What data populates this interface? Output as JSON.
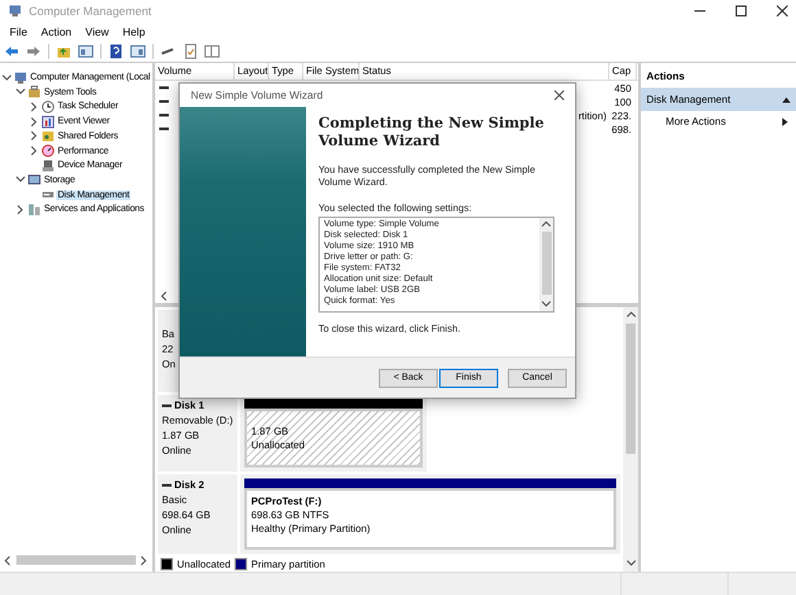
{
  "window": {
    "title": "Computer Management"
  },
  "menu": [
    "File",
    "Action",
    "View",
    "Help"
  ],
  "tree": [
    {
      "label": "Computer Management (Local",
      "selected": false,
      "expanded": true,
      "children": [
        {
          "label": "System Tools",
          "selected": false,
          "expanded": true,
          "children": [
            {
              "label": "Task Scheduler",
              "selected": false,
              "expanded": false
            },
            {
              "label": "Event Viewer",
              "selected": false,
              "expanded": false
            },
            {
              "label": "Shared Folders",
              "selected": false,
              "expanded": false
            },
            {
              "label": "Performance",
              "selected": false,
              "expanded": false
            },
            {
              "label": "Device Manager",
              "selected": false
            }
          ]
        },
        {
          "label": "Storage",
          "selected": false,
          "expanded": true,
          "children": [
            {
              "label": "Disk Management",
              "selected": true
            }
          ]
        },
        {
          "label": "Services and Applications",
          "selected": false,
          "expanded": false
        }
      ]
    }
  ],
  "volumes": {
    "columns": [
      "Volume",
      "Layout",
      "Type",
      "File System",
      "Status",
      "Cap"
    ],
    "rows": [
      {
        "cap": "450"
      },
      {
        "cap": "100"
      },
      {
        "status": "rtition)",
        "cap": "223."
      },
      {
        "cap": "698."
      }
    ]
  },
  "disks": [
    {
      "lines": [
        "Ba",
        "22",
        "On"
      ]
    },
    {
      "name": "Disk 1",
      "lines": [
        "Removable (D:)",
        "1.87 GB",
        "Online"
      ],
      "partition": {
        "kind": "unallocated",
        "lines": [
          "1.87 GB",
          "Unallocated"
        ]
      }
    },
    {
      "name": "Disk 2",
      "lines": [
        "Basic",
        "698.64 GB",
        "Online"
      ],
      "partition": {
        "kind": "primary",
        "title": "PCProTest  (F:)",
        "lines": [
          "698.63 GB NTFS",
          "Healthy (Primary Partition)"
        ]
      }
    }
  ],
  "legend": [
    {
      "label": "Unallocated",
      "color": "#000000"
    },
    {
      "label": "Primary partition",
      "color": "#000080"
    }
  ],
  "actions": {
    "title": "Actions",
    "section": "Disk Management",
    "expanded": true,
    "items": [
      "More Actions"
    ]
  },
  "wizard": {
    "title": "New Simple Volume Wizard",
    "heading": "Completing the New Simple Volume Wizard",
    "intro": "You have successfully completed the New Simple Volume Wizard.",
    "settings_label": "You selected the following settings:",
    "settings": [
      "Volume type: Simple Volume",
      "Disk selected: Disk 1",
      "Volume size: 1910 MB",
      "Drive letter or path: G:",
      "File system: FAT32",
      "Allocation unit size: Default",
      "Volume label: USB 2GB",
      "Quick format: Yes"
    ],
    "closing": "To close this wizard, click Finish.",
    "buttons": [
      {
        "label": "< Back",
        "default": false
      },
      {
        "label": "Finish",
        "default": true
      },
      {
        "label": "Cancel",
        "default": false
      }
    ]
  }
}
